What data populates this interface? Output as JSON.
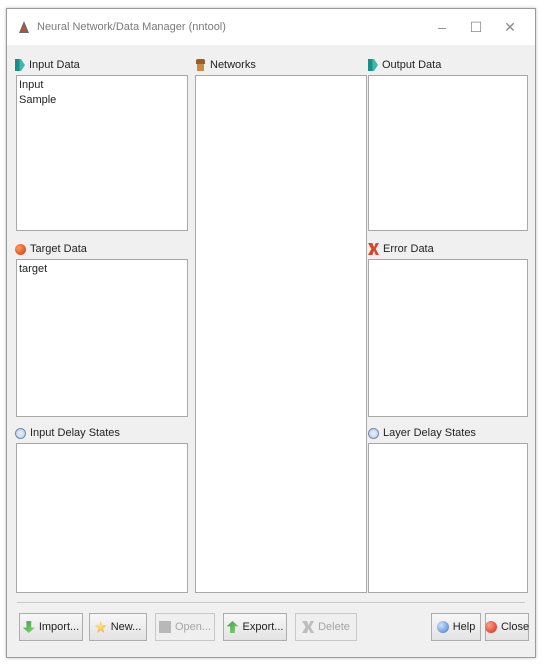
{
  "window": {
    "title": "Neural Network/Data Manager (nntool)",
    "controls": {
      "minimize": "–",
      "maximize": "☐",
      "close": "✕"
    }
  },
  "panels": {
    "input_data": {
      "label": "Input Data",
      "icon": "input-data-icon",
      "items": [
        "Input",
        "Sample"
      ]
    },
    "networks": {
      "label": "Networks",
      "icon": "network-icon",
      "items": []
    },
    "output_data": {
      "label": "Output Data",
      "icon": "output-data-icon",
      "items": []
    },
    "target_data": {
      "label": "Target Data",
      "icon": "target-data-icon",
      "items": [
        "target"
      ]
    },
    "error_data": {
      "label": "Error Data",
      "icon": "error-data-icon",
      "items": []
    },
    "input_delay_states": {
      "label": "Input Delay States",
      "icon": "delay-states-icon",
      "items": []
    },
    "layer_delay_states": {
      "label": "Layer Delay States",
      "icon": "delay-states-icon",
      "items": []
    }
  },
  "buttons": {
    "import": {
      "label": "Import...",
      "enabled": true
    },
    "new": {
      "label": "New...",
      "enabled": true
    },
    "open": {
      "label": "Open...",
      "enabled": false
    },
    "export": {
      "label": "Export...",
      "enabled": true
    },
    "delete": {
      "label": "Delete",
      "enabled": false
    },
    "help": {
      "label": "Help",
      "enabled": true
    },
    "close": {
      "label": "Close",
      "enabled": true
    }
  }
}
